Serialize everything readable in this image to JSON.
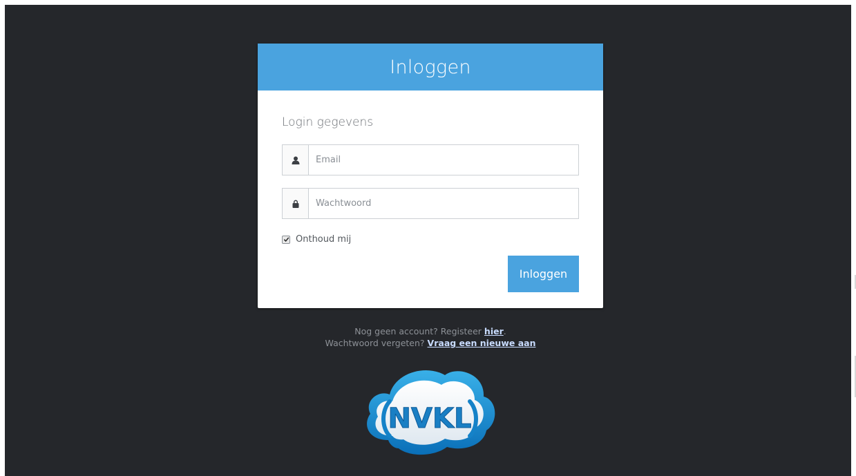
{
  "login": {
    "header_title": "Inloggen",
    "section_title": "Login gegevens",
    "email_placeholder": "Email",
    "password_placeholder": "Wachtwoord",
    "remember_label": "Onthoud mij",
    "remember_checked": true,
    "submit_label": "Inloggen"
  },
  "footer": {
    "register_text": "Nog geen account? Registeer ",
    "register_link": "hier",
    "register_suffix": ".",
    "forgot_text": "Wachtwoord vergeten? ",
    "forgot_link": "Vraag een nieuwe aan"
  },
  "logo": {
    "text": "NVKL"
  },
  "colors": {
    "background": "#25272b",
    "accent": "#4aa3df",
    "link": "#c9dcff"
  },
  "icons": {
    "email": "user-icon",
    "password": "lock-icon",
    "checkbox": "checkmark-icon"
  }
}
